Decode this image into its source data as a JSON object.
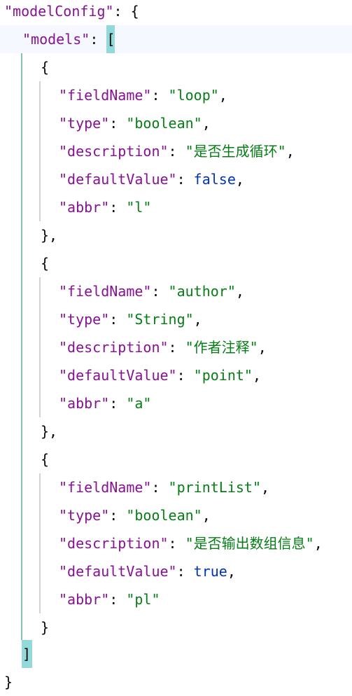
{
  "root": {
    "key": "\"modelConfig\"",
    "colon": ": ",
    "open": "{",
    "close": "}"
  },
  "models": {
    "key": "\"models\"",
    "colon": ": ",
    "open": "[",
    "close": "]"
  },
  "objects": [
    {
      "open": "{",
      "close": "},",
      "fields": [
        {
          "key": "\"fieldName\"",
          "value": "\"loop\"",
          "value_kind": "string",
          "trail": ","
        },
        {
          "key": "\"type\"",
          "value": "\"boolean\"",
          "value_kind": "string",
          "trail": ","
        },
        {
          "key": "\"description\"",
          "value": "\"是否生成循环\"",
          "value_kind": "string",
          "trail": ","
        },
        {
          "key": "\"defaultValue\"",
          "value": "false",
          "value_kind": "boolean",
          "trail": ","
        },
        {
          "key": "\"abbr\"",
          "value": "\"l\"",
          "value_kind": "string",
          "trail": ""
        }
      ]
    },
    {
      "open": "{",
      "close": "},",
      "fields": [
        {
          "key": "\"fieldName\"",
          "value": "\"author\"",
          "value_kind": "string",
          "trail": ","
        },
        {
          "key": "\"type\"",
          "value": "\"String\"",
          "value_kind": "string",
          "trail": ","
        },
        {
          "key": "\"description\"",
          "value": "\"作者注释\"",
          "value_kind": "string",
          "trail": ","
        },
        {
          "key": "\"defaultValue\"",
          "value": "\"point\"",
          "value_kind": "string",
          "trail": ","
        },
        {
          "key": "\"abbr\"",
          "value": "\"a\"",
          "value_kind": "string",
          "trail": ""
        }
      ]
    },
    {
      "open": "{",
      "close": "}",
      "fields": [
        {
          "key": "\"fieldName\"",
          "value": "\"printList\"",
          "value_kind": "string",
          "trail": ","
        },
        {
          "key": "\"type\"",
          "value": "\"boolean\"",
          "value_kind": "string",
          "trail": ","
        },
        {
          "key": "\"description\"",
          "value": "\"是否输出数组信息\"",
          "value_kind": "string",
          "trail": ","
        },
        {
          "key": "\"defaultValue\"",
          "value": "true",
          "value_kind": "boolean",
          "trail": ","
        },
        {
          "key": "\"abbr\"",
          "value": "\"pl\"",
          "value_kind": "string",
          "trail": ""
        }
      ]
    }
  ],
  "colors": {
    "key": "#871094",
    "string": "#067d17",
    "boolean": "#0033b3",
    "punctuation": "#080808",
    "bracket_highlight": "#93d9d9",
    "indent_guide_active": "#83c3b5",
    "current_line": "#f5f8fe"
  }
}
